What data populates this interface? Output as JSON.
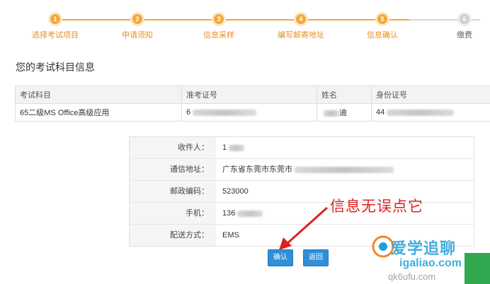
{
  "steps": [
    {
      "num": "1",
      "label": "选择考试项目"
    },
    {
      "num": "2",
      "label": "申请须知"
    },
    {
      "num": "3",
      "label": "信息采样"
    },
    {
      "num": "4",
      "label": "编写邮寄地址"
    },
    {
      "num": "5",
      "label": "信息确认"
    },
    {
      "num": "6",
      "label": "缴费"
    }
  ],
  "section_title": "您的考试科目信息",
  "subject_table": {
    "headers": [
      "考试科目",
      "准考证号",
      "姓名",
      "身份证号"
    ],
    "row": {
      "subject": "65二级MS Office高级应用",
      "ticket": "6",
      "name": "迪",
      "id": "44"
    }
  },
  "info": {
    "recipient": {
      "label": "收件人：",
      "value": "1"
    },
    "address": {
      "label": "通信地址：",
      "value": "广东省东莞市东莞市"
    },
    "postcode": {
      "label": "邮政编码：",
      "value": "523000"
    },
    "phone": {
      "label": "手机：",
      "value": "136"
    },
    "shipping": {
      "label": "配送方式：",
      "value": "EMS"
    }
  },
  "buttons": {
    "confirm": "确认",
    "back": "返回"
  },
  "annotation": "信息无误点它",
  "watermark": {
    "line1": "爱学追聊",
    "line2": "igaliao.com",
    "line3": "qk6ufu.com"
  },
  "colors": {
    "step_active": "#f2a93b",
    "step_label": "#e3902a",
    "button_blue": "#2f8fd8",
    "annotation_red": "#e02020"
  }
}
